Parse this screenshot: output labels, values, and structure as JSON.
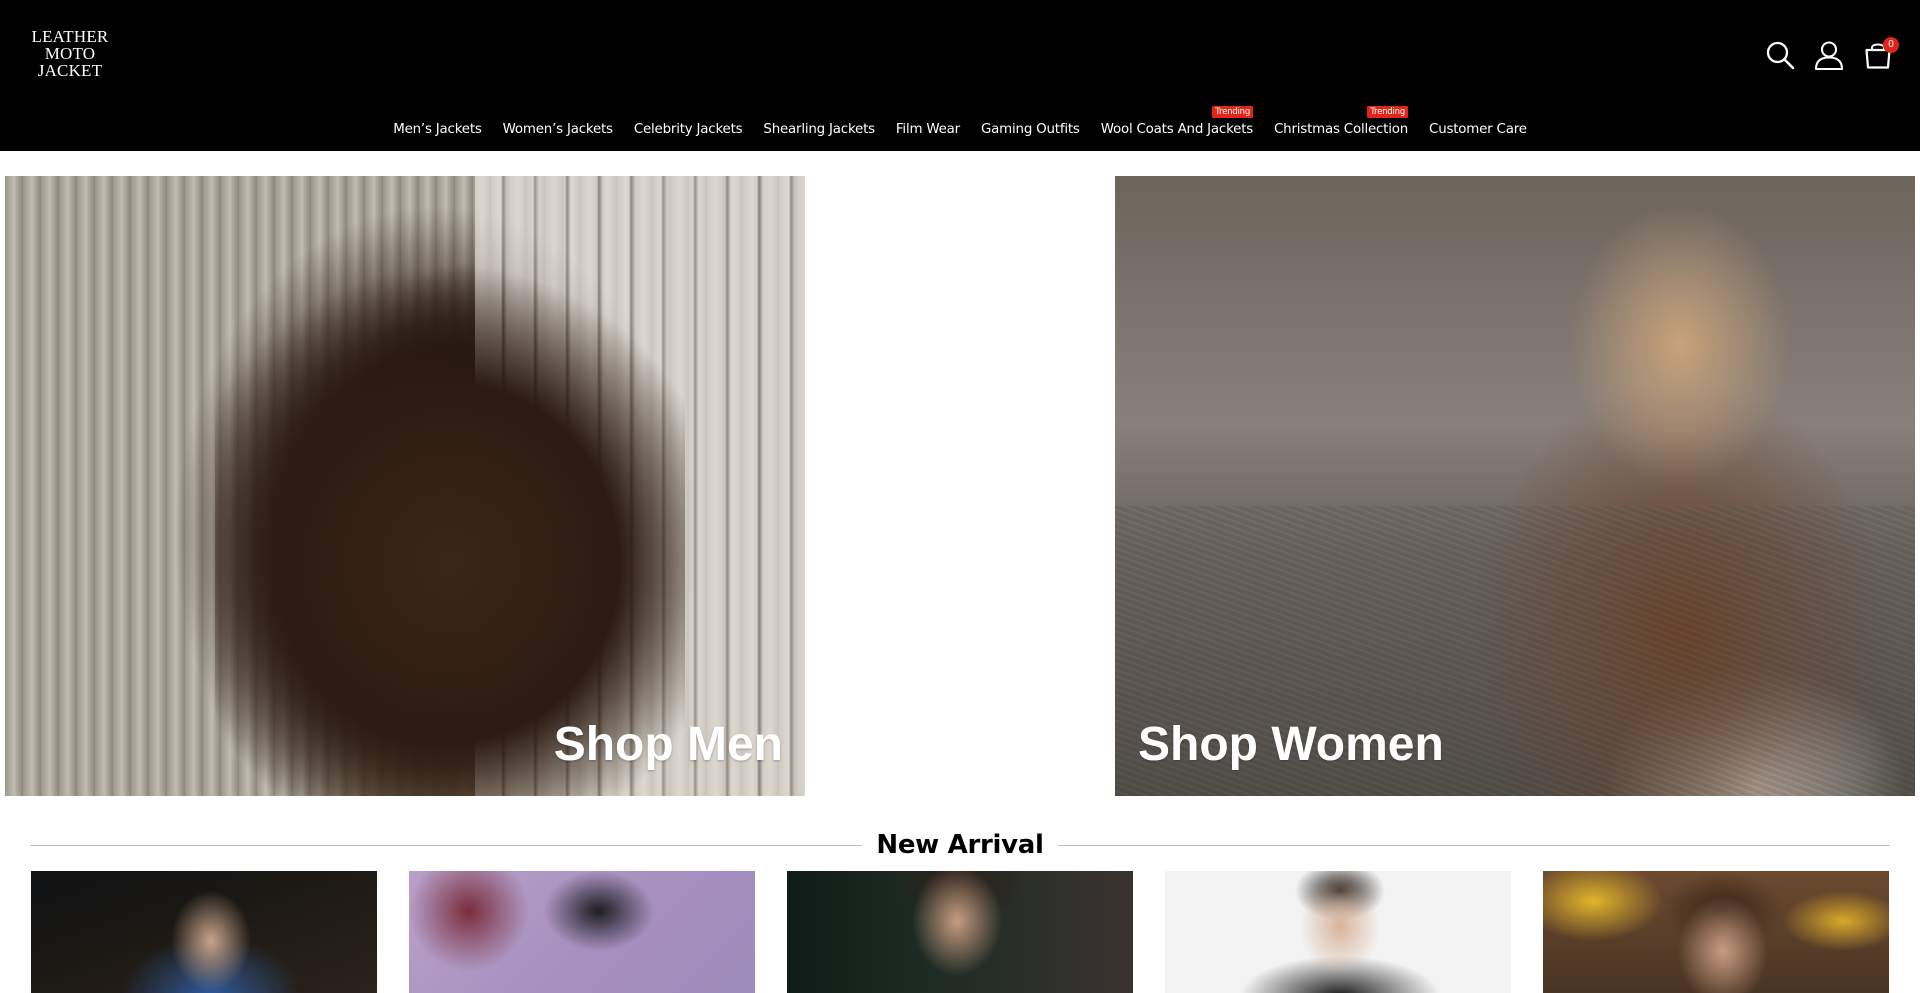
{
  "brand": {
    "logo_lines": [
      "LEATHER",
      "MOTO",
      "JACKET"
    ]
  },
  "header": {
    "icons": [
      "search-icon",
      "account-icon",
      "cart-icon"
    ],
    "cart_count": "0"
  },
  "nav": {
    "items": [
      {
        "label": "Men’s Jackets",
        "badge": ""
      },
      {
        "label": "Women’s Jackets",
        "badge": ""
      },
      {
        "label": "Celebrity Jackets",
        "badge": ""
      },
      {
        "label": "Shearling Jackets",
        "badge": ""
      },
      {
        "label": "Film Wear",
        "badge": ""
      },
      {
        "label": "Gaming Outfits",
        "badge": ""
      },
      {
        "label": "Wool Coats And Jackets",
        "badge": "Trending"
      },
      {
        "label": "Christmas Collection",
        "badge": "Trending"
      },
      {
        "label": "Customer Care",
        "badge": ""
      }
    ]
  },
  "hero": {
    "men_label": "Shop Men",
    "women_label": "Shop Women"
  },
  "new_arrival": {
    "title": "New Arrival",
    "products": [
      {
        "image": "product-image-1"
      },
      {
        "image": "product-image-2"
      },
      {
        "image": "product-image-3"
      },
      {
        "image": "product-image-4"
      },
      {
        "image": "product-image-5"
      }
    ]
  },
  "colors": {
    "header_bg": "#000000",
    "badge_red": "#e1251b",
    "text_white": "#ffffff"
  }
}
